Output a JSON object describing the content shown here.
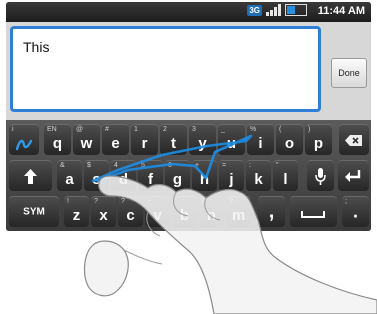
{
  "status_bar": {
    "network": "3G",
    "time": "11:44 AM"
  },
  "editor": {
    "text": "This",
    "done_label": "Done"
  },
  "keyboard": {
    "row1": [
      {
        "main": "q",
        "alt": "EN"
      },
      {
        "main": "w",
        "alt": "@"
      },
      {
        "main": "e",
        "alt": "#"
      },
      {
        "main": "r",
        "alt": "1"
      },
      {
        "main": "t",
        "alt": "2"
      },
      {
        "main": "y",
        "alt": "3"
      },
      {
        "main": "u",
        "alt": "_"
      },
      {
        "main": "i",
        "alt": "%"
      },
      {
        "main": "o",
        "alt": "("
      },
      {
        "main": "p",
        "alt": ")"
      }
    ],
    "row2": [
      {
        "main": "a",
        "alt": "&"
      },
      {
        "main": "s",
        "alt": "$"
      },
      {
        "main": "d",
        "alt": "4"
      },
      {
        "main": "f",
        "alt": "5"
      },
      {
        "main": "g",
        "alt": "6"
      },
      {
        "main": "h",
        "alt": "+"
      },
      {
        "main": "j",
        "alt": "="
      },
      {
        "main": "k",
        "alt": ":"
      },
      {
        "main": "l",
        "alt": "\""
      }
    ],
    "row3": [
      {
        "main": "z",
        "alt": "!"
      },
      {
        "main": "x",
        "alt": "?"
      },
      {
        "main": "c",
        "alt": "?"
      },
      {
        "main": "v",
        "alt": "-"
      },
      {
        "main": "b",
        "alt": "'"
      },
      {
        "main": "n",
        "alt": "/"
      },
      {
        "main": "m",
        "alt": "?"
      }
    ],
    "sym_label": "SYM",
    "help_alt": "i",
    "comma": ",",
    "period": ".",
    "colon_alt": ";",
    "icons": {
      "swype": "swype-logo-icon",
      "backspace": "backspace-icon",
      "shift": "shift-icon",
      "mic": "microphone-icon",
      "enter": "enter-icon",
      "space": "space-icon"
    }
  },
  "colors": {
    "accent": "#2f7fd6",
    "trace": "#1c8ee6"
  }
}
